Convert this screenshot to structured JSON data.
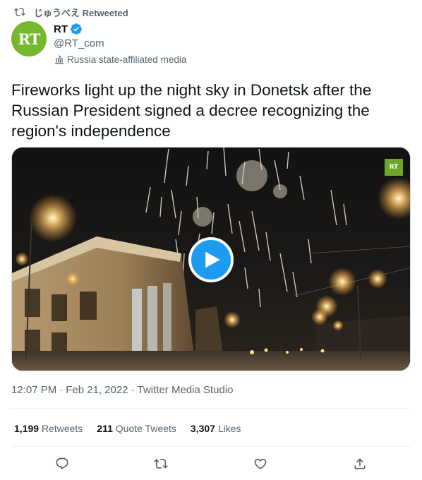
{
  "retweet_banner": {
    "label": "じゅうべえ Retweeted",
    "icon": "retweet-icon"
  },
  "author": {
    "avatar_text": "RT",
    "avatar_color": "#75b72d",
    "name": "RT",
    "verified_icon": "verified-badge-icon",
    "handle": "@RT_com",
    "affiliation": "Russia state-affiliated media",
    "affiliation_icon": "state-media-flag-icon"
  },
  "tweet": {
    "text": "Fireworks light up the night sky in Donetsk after the Russian President signed a decree recognizing the region's independence"
  },
  "media": {
    "type": "video",
    "watermark": "RT",
    "play_icon": "play-icon",
    "accent_color": "#1d9bf0"
  },
  "meta": {
    "time": "12:07 PM",
    "date": "Feb 21, 2022",
    "source": "Twitter Media Studio",
    "separator": "·"
  },
  "stats": {
    "retweets_count": "1,199",
    "retweets_label": "Retweets",
    "quotes_count": "211",
    "quotes_label": "Quote Tweets",
    "likes_count": "3,307",
    "likes_label": "Likes"
  },
  "actions": [
    "reply-icon",
    "retweet-icon",
    "like-icon",
    "share-icon"
  ]
}
